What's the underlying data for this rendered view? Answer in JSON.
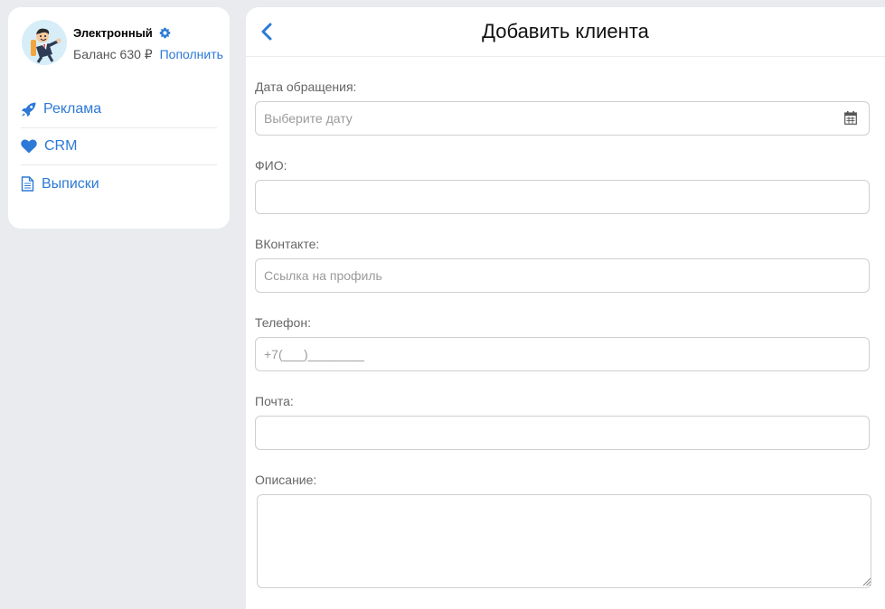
{
  "profile": {
    "name": "Электронный",
    "balance_label": "Баланс 630 ₽",
    "topup_label": "Пополнить",
    "avatar_icon": "businessman-avatar",
    "settings_icon": "gear-icon"
  },
  "menu": [
    {
      "label": "Реклама",
      "icon": "rocket-icon"
    },
    {
      "label": "CRM",
      "icon": "heart-icon"
    },
    {
      "label": "Выписки",
      "icon": "document-icon"
    }
  ],
  "header": {
    "title": "Добавить клиента",
    "back_icon": "chevron-left-icon"
  },
  "form": {
    "date": {
      "label": "Дата обращения:",
      "placeholder": "Выберите дату",
      "icon": "calendar-icon"
    },
    "fio": {
      "label": "ФИО:",
      "value": ""
    },
    "vk": {
      "label": "ВКонтакте:",
      "placeholder": "Ссылка на профиль"
    },
    "phone": {
      "label": "Телефон:",
      "placeholder": "+7(___)________"
    },
    "email": {
      "label": "Почта:",
      "value": ""
    },
    "description": {
      "label": "Описание:",
      "value": ""
    }
  },
  "colors": {
    "accent": "#2c79d6",
    "background": "#e9ebee",
    "panel": "#ffffff",
    "border": "#cfcfcf"
  }
}
